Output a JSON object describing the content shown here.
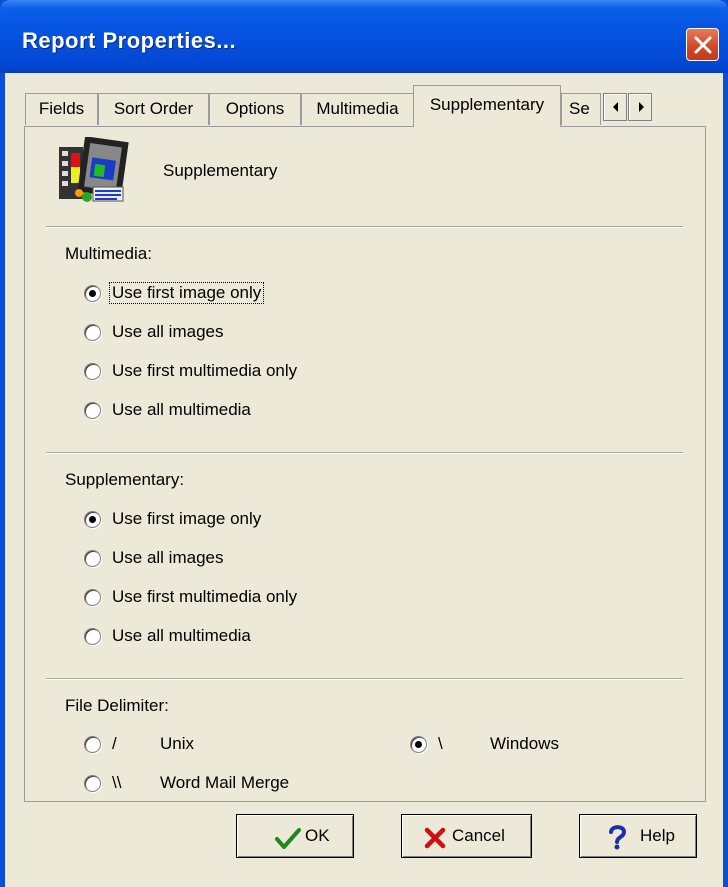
{
  "window": {
    "title": "Report Properties..."
  },
  "tabs": [
    {
      "label": "Fields"
    },
    {
      "label": "Sort Order"
    },
    {
      "label": "Options"
    },
    {
      "label": "Multimedia"
    },
    {
      "label": "Supplementary"
    },
    {
      "label": "Se"
    }
  ],
  "header": {
    "label": "Supplementary",
    "icon": "film-report-icon"
  },
  "multimedia": {
    "label": "Multimedia:",
    "options": [
      {
        "label": "Use first image only",
        "checked": true
      },
      {
        "label": "Use all images",
        "checked": false
      },
      {
        "label": "Use first multimedia only",
        "checked": false
      },
      {
        "label": "Use all multimedia",
        "checked": false
      }
    ]
  },
  "supplementary": {
    "label": "Supplementary:",
    "options": [
      {
        "label": "Use first image only",
        "checked": true
      },
      {
        "label": "Use all images",
        "checked": false
      },
      {
        "label": "Use first multimedia only",
        "checked": false
      },
      {
        "label": "Use all multimedia",
        "checked": false
      }
    ]
  },
  "file_delimiter": {
    "label": "File Delimiter:",
    "options": [
      {
        "symbol": "/",
        "label": "Unix",
        "checked": false
      },
      {
        "symbol": "\\",
        "label": "Windows",
        "checked": true
      },
      {
        "symbol": "\\\\",
        "label": "Word Mail Merge",
        "checked": false
      }
    ]
  },
  "buttons": {
    "ok": "OK",
    "cancel": "Cancel",
    "help": "Help"
  },
  "colors": {
    "titlebar": "#0551e0",
    "close": "#d24a2a",
    "face": "#ece9d8"
  }
}
